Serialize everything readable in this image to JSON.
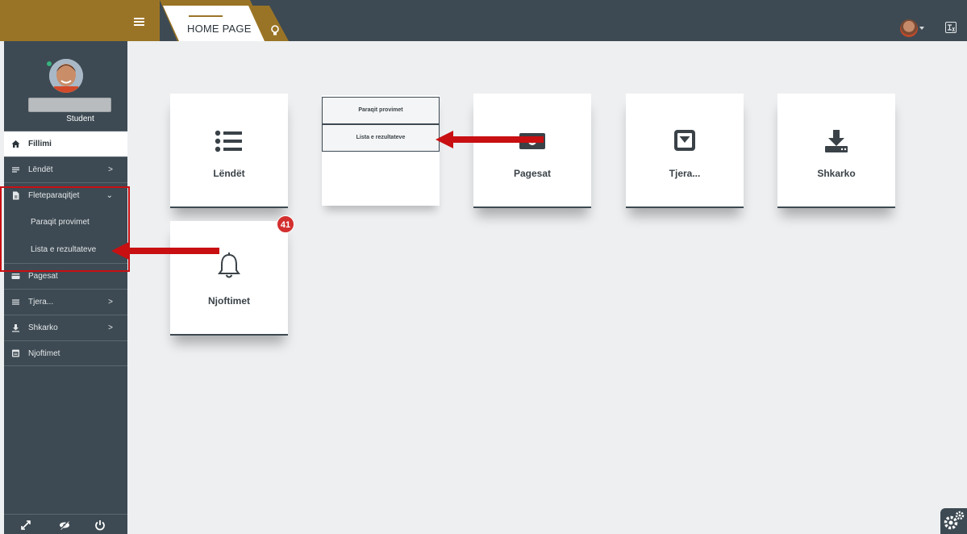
{
  "topbar": {
    "tab_label": "HOME PAGE",
    "brand_color": "#9a7426",
    "bar_color": "#3d4a53"
  },
  "sidebar": {
    "role": "Student",
    "items": [
      {
        "label": "Fillimi",
        "icon": "home-icon"
      },
      {
        "label": "Lëndët",
        "icon": "list-icon"
      },
      {
        "label": "Fleteparaqitjet",
        "icon": "document-icon"
      },
      {
        "label": "Pagesat",
        "icon": "card-icon"
      },
      {
        "label": "Tjera...",
        "icon": "lines-icon"
      },
      {
        "label": "Shkarko",
        "icon": "download-icon"
      },
      {
        "label": "Njoftimet",
        "icon": "calendar-icon"
      }
    ],
    "subitems": [
      {
        "label": "Paraqit provimet"
      },
      {
        "label": "Lista e rezultateve"
      }
    ]
  },
  "tiles": [
    {
      "label": "Lëndët",
      "icon": "list-icon"
    },
    {
      "label": "Pagesat",
      "icon": "money-icon"
    },
    {
      "label": "Tjera...",
      "icon": "caret-box-icon"
    },
    {
      "label": "Shkarko",
      "icon": "download-icon"
    },
    {
      "label": "Njoftimet",
      "icon": "bell-icon"
    }
  ],
  "dropdown": {
    "items": [
      {
        "label": "Paraqit provimet"
      },
      {
        "label": "Lista e rezultateve"
      }
    ]
  },
  "notifications": {
    "badge": "41"
  },
  "colors": {
    "highlight": "#c80f12",
    "badge": "#d32f2f"
  }
}
